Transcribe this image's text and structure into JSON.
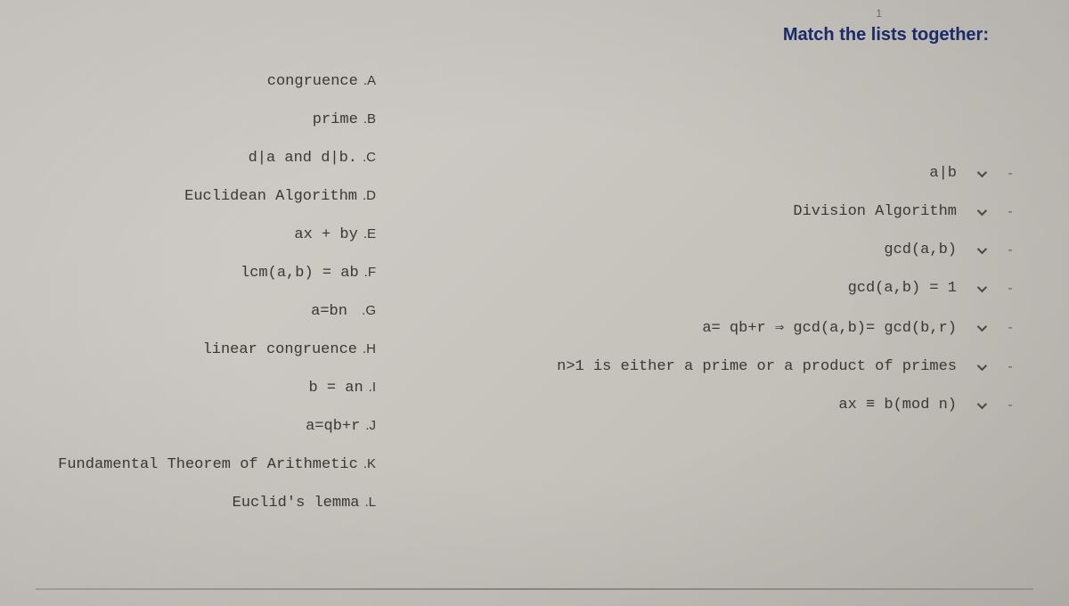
{
  "page_number": "1",
  "header": "Match the lists together:",
  "left_items": [
    {
      "text": "congruence",
      "tag": ".A"
    },
    {
      "text": "prime",
      "tag": ".B"
    },
    {
      "text": "d|a and d|b.",
      "tag": ".C"
    },
    {
      "text": "Euclidean Algorithm",
      "tag": ".D"
    },
    {
      "text": "ax + by",
      "tag": ".E"
    },
    {
      "text": "lcm(a,b) = ab",
      "tag": ".F"
    },
    {
      "text": "a=bn ",
      "tag": ".G"
    },
    {
      "text": "linear congruence",
      "tag": ".H"
    },
    {
      "text": "b = an",
      "tag": ".I"
    },
    {
      "text": "a=qb+r",
      "tag": ".J"
    },
    {
      "text": "Fundamental Theorem of Arithmetic",
      "tag": ".K"
    },
    {
      "text": "Euclid's lemma",
      "tag": ".L"
    }
  ],
  "right_items": [
    {
      "text": "a|b",
      "dash": "-"
    },
    {
      "text": "Division Algorithm",
      "dash": "-"
    },
    {
      "text": "gcd(a,b)",
      "dash": "-"
    },
    {
      "text": "gcd(a,b) = 1",
      "dash": "-"
    },
    {
      "text": "a= qb+r ⇒ gcd(a,b)= gcd(b,r)",
      "dash": "-"
    },
    {
      "text": "n>1 is either a prime or a product of primes",
      "dash": "-"
    },
    {
      "text": "ax ≡ b(mod n)",
      "dash": "-"
    }
  ]
}
